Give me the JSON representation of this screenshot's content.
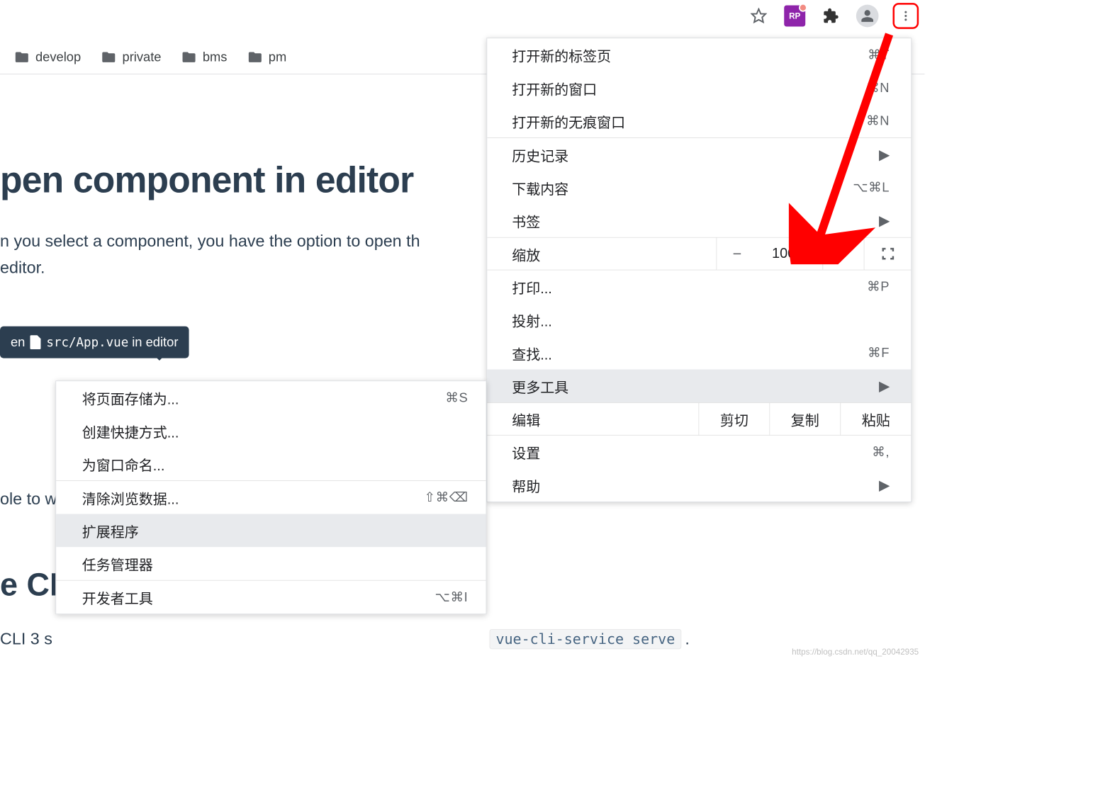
{
  "toolbar": {
    "rp_label": "RP"
  },
  "bookmarks": [
    {
      "label": "develop"
    },
    {
      "label": "private"
    },
    {
      "label": "bms"
    },
    {
      "label": "pm"
    }
  ],
  "page": {
    "title": "pen component in editor",
    "para_line1": "n you select a component, you have the option to open th",
    "para_line2": "editor.",
    "tooltip_prefix": "en",
    "tooltip_path": "src/App.vue",
    "tooltip_suffix": "in editor",
    "frag1": "ole to w",
    "section_head": "e CL",
    "frag2": "CLI 3 s",
    "code_tail": "vue-cli-service serve",
    "tail_dot": "."
  },
  "menu": {
    "new_tab": {
      "label": "打开新的标签页",
      "shortcut": "⌘T"
    },
    "new_window": {
      "label": "打开新的窗口",
      "shortcut": "⌘N"
    },
    "incognito": {
      "label": "打开新的无痕窗口",
      "shortcut": "⇧⌘N"
    },
    "history": {
      "label": "历史记录"
    },
    "downloads": {
      "label": "下载内容",
      "shortcut": "⌥⌘L"
    },
    "bookmarks": {
      "label": "书签"
    },
    "zoom": {
      "label": "缩放",
      "value": "100%"
    },
    "print": {
      "label": "打印...",
      "shortcut": "⌘P"
    },
    "cast": {
      "label": "投射..."
    },
    "find": {
      "label": "查找...",
      "shortcut": "⌘F"
    },
    "more_tools": {
      "label": "更多工具"
    },
    "edit": {
      "label": "编辑",
      "cut": "剪切",
      "copy": "复制",
      "paste": "粘贴"
    },
    "settings": {
      "label": "设置",
      "shortcut": "⌘,"
    },
    "help": {
      "label": "帮助"
    }
  },
  "submenu": {
    "save_as": {
      "label": "将页面存储为...",
      "shortcut": "⌘S"
    },
    "create_shortcut": {
      "label": "创建快捷方式..."
    },
    "name_window": {
      "label": "为窗口命名..."
    },
    "clear_data": {
      "label": "清除浏览数据...",
      "shortcut": "⇧⌘⌫"
    },
    "extensions": {
      "label": "扩展程序"
    },
    "task_manager": {
      "label": "任务管理器"
    },
    "dev_tools": {
      "label": "开发者工具",
      "shortcut": "⌥⌘I"
    }
  },
  "watermark": "https://blog.csdn.net/qq_20042935"
}
